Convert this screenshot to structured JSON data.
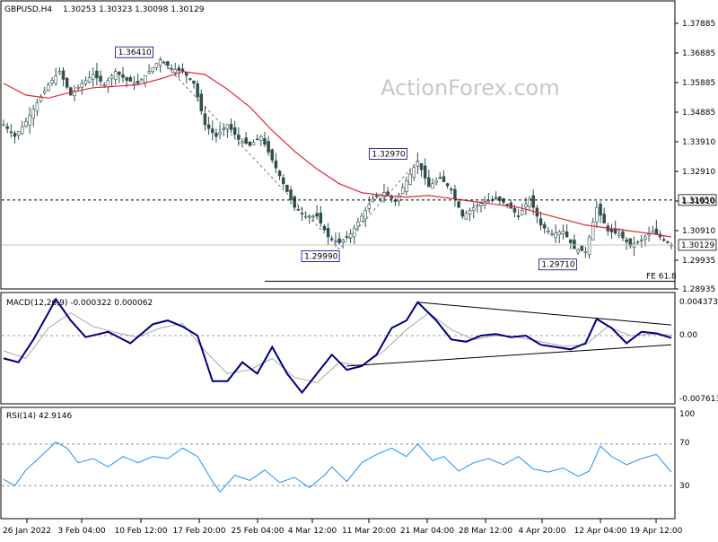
{
  "header": {
    "symbol": "GBPUSD,H4",
    "ohlc": "1.30253 1.30323 1.30098 1.30129"
  },
  "watermark": "ActionForex.com",
  "colors": {
    "candle": "#2f4f4f",
    "ma": "#e32636",
    "macd_line": "#000080",
    "macd_signal": "#a9a9a9",
    "trendline": "#000000",
    "level_line": "#000000",
    "rsi": "#1e90ff",
    "grid": "#808080"
  },
  "chart_data": [
    {
      "type": "candlestick",
      "title": "GBPUSD,H4 1.30253 1.30323 1.30098 1.30129",
      "y_ticks": [
        "1.37885",
        "1.36885",
        "1.35885",
        "1.34885",
        "1.33910",
        "1.32910",
        "1.31910",
        "1.30910",
        "1.29935",
        "1.28935"
      ],
      "x_ticks": [
        "26 Jan 2022",
        "3 Feb 04:00",
        "10 Feb 12:00",
        "17 Feb 20:00",
        "25 Feb 04:00",
        "4 Mar 12:00",
        "11 Mar 20:00",
        "21 Mar 04:00",
        "28 Mar 12:00",
        "4 Apr 20:00",
        "12 Apr 04:00",
        "19 Apr 12:00"
      ],
      "ylim": [
        1.2876,
        1.3827
      ],
      "close_path": [
        {
          "i": 0,
          "v": 1.342
        },
        {
          "i": 3,
          "v": 1.338
        },
        {
          "i": 6,
          "v": 1.343
        },
        {
          "i": 9,
          "v": 1.3495
        },
        {
          "i": 12,
          "v": 1.3555
        },
        {
          "i": 15,
          "v": 1.36
        },
        {
          "i": 18,
          "v": 1.352
        },
        {
          "i": 21,
          "v": 1.356
        },
        {
          "i": 24,
          "v": 1.359
        },
        {
          "i": 27,
          "v": 1.3555
        },
        {
          "i": 30,
          "v": 1.36
        },
        {
          "i": 33,
          "v": 1.357
        },
        {
          "i": 36,
          "v": 1.356
        },
        {
          "i": 39,
          "v": 1.36
        },
        {
          "i": 42,
          "v": 1.3641
        },
        {
          "i": 45,
          "v": 1.361
        },
        {
          "i": 48,
          "v": 1.36
        },
        {
          "i": 51,
          "v": 1.356
        },
        {
          "i": 54,
          "v": 1.342
        },
        {
          "i": 57,
          "v": 1.338
        },
        {
          "i": 60,
          "v": 1.342
        },
        {
          "i": 63,
          "v": 1.337
        },
        {
          "i": 66,
          "v": 1.335
        },
        {
          "i": 69,
          "v": 1.338
        },
        {
          "i": 72,
          "v": 1.33
        },
        {
          "i": 75,
          "v": 1.322
        },
        {
          "i": 78,
          "v": 1.314
        },
        {
          "i": 81,
          "v": 1.311
        },
        {
          "i": 84,
          "v": 1.311
        },
        {
          "i": 87,
          "v": 1.304
        },
        {
          "i": 90,
          "v": 1.302
        },
        {
          "i": 93,
          "v": 1.305
        },
        {
          "i": 96,
          "v": 1.311
        },
        {
          "i": 99,
          "v": 1.317
        },
        {
          "i": 102,
          "v": 1.319
        },
        {
          "i": 105,
          "v": 1.316
        },
        {
          "i": 108,
          "v": 1.323
        },
        {
          "i": 111,
          "v": 1.3297
        },
        {
          "i": 114,
          "v": 1.321
        },
        {
          "i": 117,
          "v": 1.324
        },
        {
          "i": 120,
          "v": 1.32
        },
        {
          "i": 123,
          "v": 1.311
        },
        {
          "i": 126,
          "v": 1.314
        },
        {
          "i": 129,
          "v": 1.316
        },
        {
          "i": 132,
          "v": 1.317
        },
        {
          "i": 135,
          "v": 1.315
        },
        {
          "i": 138,
          "v": 1.311
        },
        {
          "i": 141,
          "v": 1.317
        },
        {
          "i": 144,
          "v": 1.308
        },
        {
          "i": 147,
          "v": 1.305
        },
        {
          "i": 150,
          "v": 1.306
        },
        {
          "i": 153,
          "v": 1.3
        },
        {
          "i": 156,
          "v": 1.299
        },
        {
          "i": 159,
          "v": 1.314
        },
        {
          "i": 162,
          "v": 1.306
        },
        {
          "i": 165,
          "v": 1.305
        },
        {
          "i": 168,
          "v": 1.301
        },
        {
          "i": 171,
          "v": 1.303
        },
        {
          "i": 174,
          "v": 1.306
        },
        {
          "i": 177,
          "v": 1.303
        },
        {
          "i": 179,
          "v": 1.3013
        }
      ],
      "ma_path": [
        {
          "i": 0,
          "v": 1.356
        },
        {
          "i": 6,
          "v": 1.352
        },
        {
          "i": 12,
          "v": 1.351
        },
        {
          "i": 18,
          "v": 1.353
        },
        {
          "i": 24,
          "v": 1.3545
        },
        {
          "i": 30,
          "v": 1.355
        },
        {
          "i": 36,
          "v": 1.3555
        },
        {
          "i": 42,
          "v": 1.3575
        },
        {
          "i": 48,
          "v": 1.36
        },
        {
          "i": 54,
          "v": 1.359
        },
        {
          "i": 60,
          "v": 1.354
        },
        {
          "i": 66,
          "v": 1.348
        },
        {
          "i": 72,
          "v": 1.34
        },
        {
          "i": 78,
          "v": 1.333
        },
        {
          "i": 84,
          "v": 1.327
        },
        {
          "i": 90,
          "v": 1.322
        },
        {
          "i": 96,
          "v": 1.319
        },
        {
          "i": 102,
          "v": 1.318
        },
        {
          "i": 108,
          "v": 1.3175
        },
        {
          "i": 114,
          "v": 1.318
        },
        {
          "i": 120,
          "v": 1.317
        },
        {
          "i": 126,
          "v": 1.316
        },
        {
          "i": 132,
          "v": 1.315
        },
        {
          "i": 138,
          "v": 1.314
        },
        {
          "i": 144,
          "v": 1.312
        },
        {
          "i": 150,
          "v": 1.31
        },
        {
          "i": 156,
          "v": 1.308
        },
        {
          "i": 162,
          "v": 1.307
        },
        {
          "i": 168,
          "v": 1.306
        },
        {
          "i": 174,
          "v": 1.305
        },
        {
          "i": 179,
          "v": 1.304
        }
      ],
      "bars_total": 180,
      "swing_labels": [
        {
          "text": "1.36410",
          "i": 42,
          "v": 1.3641
        },
        {
          "text": "1.32970",
          "i": 111,
          "v": 1.3297
        },
        {
          "text": "1.29990",
          "i": 90,
          "v": 1.2999
        },
        {
          "text": "1.29710",
          "i": 156,
          "v": 1.2971
        }
      ],
      "zigzag": [
        {
          "i": 42,
          "v": 1.3641
        },
        {
          "i": 90,
          "v": 1.2999
        },
        {
          "i": 111,
          "v": 1.3297
        }
      ],
      "levels": [
        {
          "label": "1.31650",
          "value": 1.3165,
          "style": "dashed"
        },
        {
          "label": "1.30129",
          "value": 1.30129,
          "style": "solid",
          "color": "#c0c0c0"
        },
        {
          "label": "FE 61.8",
          "value": 1.289,
          "style": "solid",
          "from_i": 70
        }
      ]
    },
    {
      "type": "line",
      "title": "MACD(12,26,9) -0.000322 0.000062",
      "y_ticks": [
        "0.004373",
        "0.00",
        "-0.007613"
      ],
      "ylim": [
        -0.0085,
        0.0052
      ],
      "zero_label": "0.00",
      "series": [
        {
          "name": "MACD",
          "points": [
            {
              "i": 0,
              "v": -0.003
            },
            {
              "i": 4,
              "v": -0.0035
            },
            {
              "i": 8,
              "v": -0.0005
            },
            {
              "i": 12,
              "v": 0.003
            },
            {
              "i": 14,
              "v": 0.0048
            },
            {
              "i": 18,
              "v": 0.002
            },
            {
              "i": 22,
              "v": -0.0002
            },
            {
              "i": 28,
              "v": 0.0005
            },
            {
              "i": 34,
              "v": -0.001
            },
            {
              "i": 40,
              "v": 0.0015
            },
            {
              "i": 44,
              "v": 0.002
            },
            {
              "i": 48,
              "v": 0.0012
            },
            {
              "i": 52,
              "v": 0.0
            },
            {
              "i": 56,
              "v": -0.006
            },
            {
              "i": 60,
              "v": -0.006
            },
            {
              "i": 64,
              "v": -0.0035
            },
            {
              "i": 68,
              "v": -0.005
            },
            {
              "i": 72,
              "v": -0.0015
            },
            {
              "i": 76,
              "v": -0.005
            },
            {
              "i": 80,
              "v": -0.0075
            },
            {
              "i": 84,
              "v": -0.005
            },
            {
              "i": 88,
              "v": -0.0025
            },
            {
              "i": 92,
              "v": -0.0045
            },
            {
              "i": 96,
              "v": -0.004
            },
            {
              "i": 100,
              "v": -0.0025
            },
            {
              "i": 104,
              "v": 0.001
            },
            {
              "i": 108,
              "v": 0.002
            },
            {
              "i": 111,
              "v": 0.0044
            },
            {
              "i": 116,
              "v": 0.002
            },
            {
              "i": 120,
              "v": -0.0005
            },
            {
              "i": 124,
              "v": -0.0008
            },
            {
              "i": 128,
              "v": 0.0
            },
            {
              "i": 132,
              "v": 0.0002
            },
            {
              "i": 136,
              "v": -0.0002
            },
            {
              "i": 140,
              "v": 0.0
            },
            {
              "i": 144,
              "v": -0.0012
            },
            {
              "i": 148,
              "v": -0.0015
            },
            {
              "i": 152,
              "v": -0.0018
            },
            {
              "i": 156,
              "v": -0.001
            },
            {
              "i": 159,
              "v": 0.0022
            },
            {
              "i": 163,
              "v": 0.001
            },
            {
              "i": 167,
              "v": -0.001
            },
            {
              "i": 171,
              "v": 0.0005
            },
            {
              "i": 175,
              "v": 0.0003
            },
            {
              "i": 179,
              "v": -0.0003
            }
          ]
        },
        {
          "name": "Signal",
          "points": [
            {
              "i": 0,
              "v": -0.002
            },
            {
              "i": 6,
              "v": -0.003
            },
            {
              "i": 12,
              "v": 0.001
            },
            {
              "i": 18,
              "v": 0.003
            },
            {
              "i": 24,
              "v": 0.0012
            },
            {
              "i": 30,
              "v": 0.0004
            },
            {
              "i": 36,
              "v": -0.0002
            },
            {
              "i": 42,
              "v": 0.001
            },
            {
              "i": 48,
              "v": 0.0016
            },
            {
              "i": 54,
              "v": -0.002
            },
            {
              "i": 60,
              "v": -0.005
            },
            {
              "i": 66,
              "v": -0.0045
            },
            {
              "i": 72,
              "v": -0.003
            },
            {
              "i": 78,
              "v": -0.0055
            },
            {
              "i": 84,
              "v": -0.0062
            },
            {
              "i": 90,
              "v": -0.0035
            },
            {
              "i": 96,
              "v": -0.004
            },
            {
              "i": 102,
              "v": -0.002
            },
            {
              "i": 108,
              "v": 0.0008
            },
            {
              "i": 114,
              "v": 0.003
            },
            {
              "i": 120,
              "v": 0.0008
            },
            {
              "i": 126,
              "v": -0.0005
            },
            {
              "i": 132,
              "v": 0.0
            },
            {
              "i": 138,
              "v": -0.0002
            },
            {
              "i": 144,
              "v": -0.0008
            },
            {
              "i": 150,
              "v": -0.0014
            },
            {
              "i": 156,
              "v": -0.0012
            },
            {
              "i": 162,
              "v": 0.0012
            },
            {
              "i": 168,
              "v": 0.0
            },
            {
              "i": 174,
              "v": 0.0002
            },
            {
              "i": 179,
              "v": 0.0001
            }
          ]
        }
      ],
      "trendlines": [
        {
          "from": {
            "i": 111,
            "v": 0.0044
          },
          "to": {
            "i": 179,
            "v": 0.0014
          }
        },
        {
          "from": {
            "i": 92,
            "v": -0.004
          },
          "to": {
            "i": 179,
            "v": -0.0012
          }
        }
      ]
    },
    {
      "type": "line",
      "title": "RSI(14) 42.9146",
      "y_ticks": [
        "100",
        "70",
        "30"
      ],
      "ylim": [
        0,
        100
      ],
      "levels": [
        70,
        30
      ],
      "series": [
        {
          "name": "RSI",
          "points": [
            {
              "i": 0,
              "v": 36
            },
            {
              "i": 3,
              "v": 30
            },
            {
              "i": 6,
              "v": 45
            },
            {
              "i": 9,
              "v": 55
            },
            {
              "i": 12,
              "v": 65
            },
            {
              "i": 14,
              "v": 72
            },
            {
              "i": 17,
              "v": 66
            },
            {
              "i": 20,
              "v": 52
            },
            {
              "i": 24,
              "v": 56
            },
            {
              "i": 28,
              "v": 48
            },
            {
              "i": 32,
              "v": 58
            },
            {
              "i": 36,
              "v": 52
            },
            {
              "i": 40,
              "v": 58
            },
            {
              "i": 44,
              "v": 56
            },
            {
              "i": 48,
              "v": 66
            },
            {
              "i": 52,
              "v": 58
            },
            {
              "i": 56,
              "v": 34
            },
            {
              "i": 58,
              "v": 24
            },
            {
              "i": 62,
              "v": 40
            },
            {
              "i": 66,
              "v": 35
            },
            {
              "i": 70,
              "v": 45
            },
            {
              "i": 74,
              "v": 33
            },
            {
              "i": 78,
              "v": 38
            },
            {
              "i": 82,
              "v": 28
            },
            {
              "i": 86,
              "v": 40
            },
            {
              "i": 88,
              "v": 48
            },
            {
              "i": 92,
              "v": 34
            },
            {
              "i": 96,
              "v": 52
            },
            {
              "i": 100,
              "v": 60
            },
            {
              "i": 104,
              "v": 66
            },
            {
              "i": 108,
              "v": 58
            },
            {
              "i": 111,
              "v": 70
            },
            {
              "i": 115,
              "v": 54
            },
            {
              "i": 118,
              "v": 58
            },
            {
              "i": 122,
              "v": 44
            },
            {
              "i": 126,
              "v": 52
            },
            {
              "i": 130,
              "v": 56
            },
            {
              "i": 134,
              "v": 50
            },
            {
              "i": 138,
              "v": 58
            },
            {
              "i": 142,
              "v": 46
            },
            {
              "i": 146,
              "v": 43
            },
            {
              "i": 150,
              "v": 47
            },
            {
              "i": 154,
              "v": 39
            },
            {
              "i": 157,
              "v": 44
            },
            {
              "i": 160,
              "v": 68
            },
            {
              "i": 163,
              "v": 58
            },
            {
              "i": 167,
              "v": 50
            },
            {
              "i": 171,
              "v": 56
            },
            {
              "i": 175,
              "v": 60
            },
            {
              "i": 179,
              "v": 43
            }
          ]
        }
      ]
    }
  ]
}
